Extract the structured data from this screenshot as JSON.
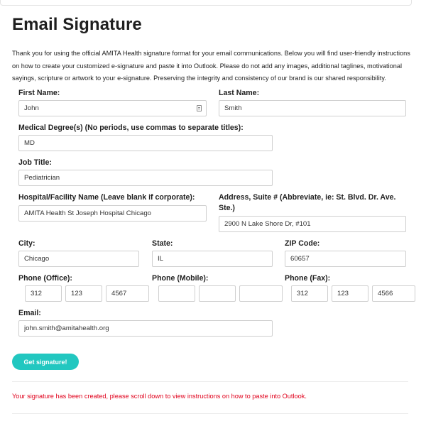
{
  "page": {
    "title": "Email Signature",
    "intro": "Thank you for using the official AMITA Health signature format for your email communications. Below you will find user-friendly instructions on how to create your customized e-signature and paste it into Outlook. Please do not add any images, additional taglines, motivational sayings, scripture or artwork to your e-signature. Preserving the integrity and consistency of our brand is our shared responsibility."
  },
  "form": {
    "first_name": {
      "label": "First Name:",
      "value": "John"
    },
    "last_name": {
      "label": "Last Name:",
      "value": "Smith"
    },
    "degree": {
      "label": "Medical Degree(s) (No periods, use commas to separate titles):",
      "value": "MD"
    },
    "job_title": {
      "label": "Job Title:",
      "value": "Pediatrician"
    },
    "hospital": {
      "label": "Hospital/Facility Name (Leave blank if corporate):",
      "value": "AMITA Health St Joseph Hospital Chicago"
    },
    "address": {
      "label": "Address, Suite # (Abbreviate, ie: St. Blvd. Dr. Ave. Ste.)",
      "value": "2900 N Lake Shore Dr, #101"
    },
    "city": {
      "label": "City:",
      "value": "Chicago"
    },
    "state": {
      "label": "State:",
      "value": "IL"
    },
    "zip": {
      "label": "ZIP Code:",
      "value": "60657"
    },
    "phone_office": {
      "label": "Phone (Office):",
      "parts": [
        "312",
        "123",
        "4567"
      ]
    },
    "phone_mobile": {
      "label": "Phone (Mobile):",
      "parts": [
        "",
        "",
        ""
      ]
    },
    "phone_fax": {
      "label": "Phone (Fax):",
      "parts": [
        "312",
        "123",
        "4566"
      ]
    },
    "email": {
      "label": "Email:",
      "value": "john.smith@amitahealth.org"
    }
  },
  "actions": {
    "submit_label": "Get signature!"
  },
  "status": {
    "message": "Your signature has been created, please scroll down to view instructions on how to paste into Outlook.",
    "message_color": "#e0001b"
  },
  "colors": {
    "accent": "#22c7c0"
  }
}
